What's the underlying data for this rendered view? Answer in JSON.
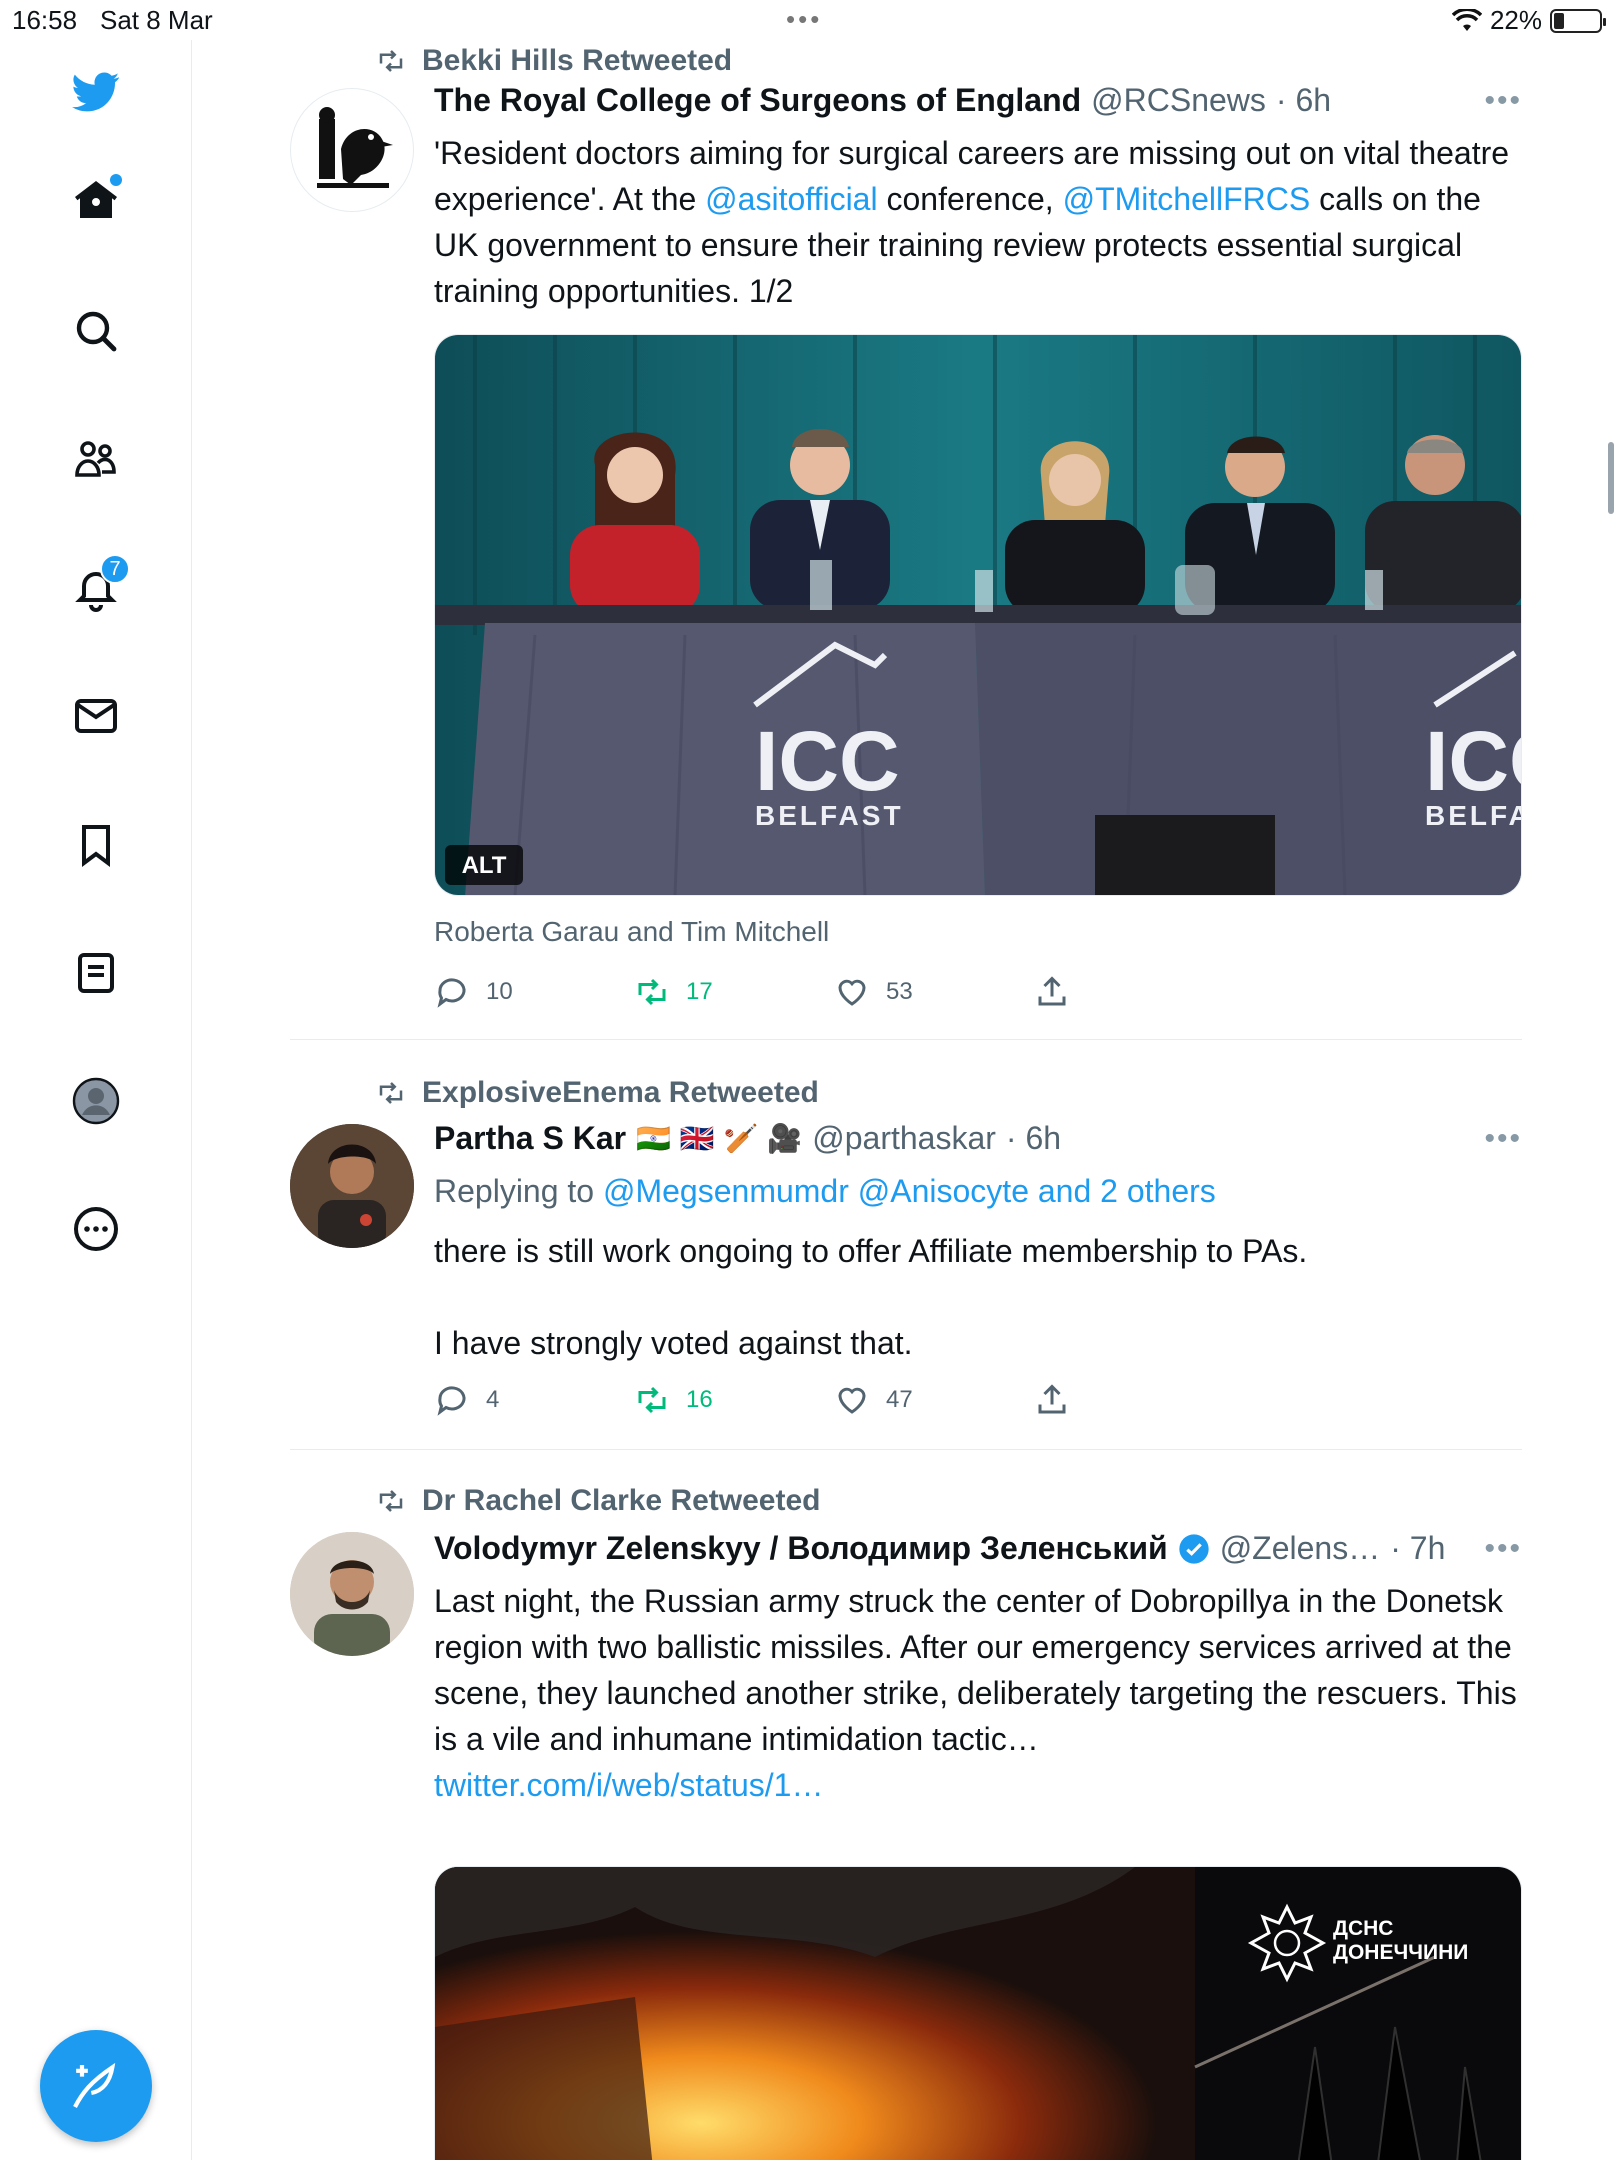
{
  "status_bar": {
    "time": "16:58",
    "date": "Sat 8 Mar",
    "battery": "22%"
  },
  "sidebar": {
    "notifications_badge": "7",
    "items": [
      "home",
      "search",
      "communities",
      "notifications",
      "messages",
      "bookmarks",
      "lists",
      "profile",
      "more"
    ]
  },
  "tweets": [
    {
      "retweeted_by": "Bekki Hills Retweeted",
      "name": "The Royal College of Surgeons of England",
      "handle": "@RCSnews",
      "time": "· 6h",
      "text_1": "'Resident doctors aiming for surgical careers are missing out on vital theatre experience'. At the ",
      "mention_1": "@asitofficial",
      "text_2": " conference, ",
      "mention_2": "@TMitchellFRCS",
      "text_3": " calls on the UK government to ensure their training review protects essential surgical training opportunities. 1/2",
      "image_badge": "ALT",
      "image_banner_main": "ICC",
      "image_banner_sub": "BELFAST",
      "image_banner_main_2": "ICC",
      "image_banner_sub_2": "BELFAST",
      "caption": "Roberta Garau and Tim Mitchell",
      "replies": "10",
      "retweets": "17",
      "likes": "53"
    },
    {
      "retweeted_by": "ExplosiveEnema Retweeted",
      "name": "Partha S Kar",
      "name_emoji": "🇮🇳 🇬🇧 🏏 🎥",
      "handle": "@parthaskar",
      "time": "· 6h",
      "replying_prefix": "Replying to ",
      "replying_to": "@Megsenmumdr @Anisocyte and 2 others",
      "text_1": "there is still work ongoing to offer Affiliate membership to PAs.",
      "text_2": "I have strongly voted against that.",
      "replies": "4",
      "retweets": "16",
      "likes": "47"
    },
    {
      "retweeted_by": "Dr Rachel Clarke Retweeted",
      "name": "Volodymyr Zelenskyy / Володимир Зеленський",
      "handle": "@Zelens…",
      "time": "· 7h",
      "text": "Last night, the Russian army struck the center of Dobropillya in the Donetsk region with two ballistic missiles. After our emergency services arrived at the scene, they launched another strike, deliberately targeting the rescuers. This is a vile and inhumane intimidation tactic…",
      "link": "twitter.com/i/web/status/1…",
      "image_watermark_1": "ДСНС",
      "image_watermark_2": "ДОНЕЧЧИНИ"
    }
  ],
  "colors": {
    "accent": "#1d9bf0",
    "retweet_green": "#00ba7c",
    "muted": "#536471"
  }
}
